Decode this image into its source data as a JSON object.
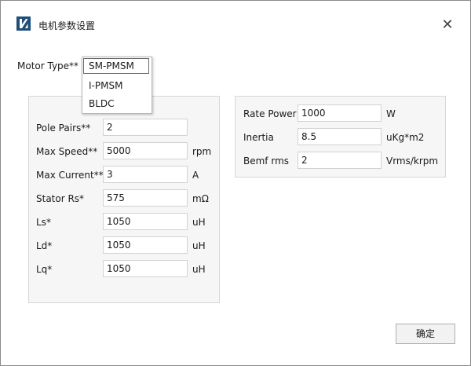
{
  "window": {
    "title": "电机参数设置",
    "app_icon": "app-logo-icon",
    "close_glyph": "✕"
  },
  "motor_type": {
    "label": "Motor Type**",
    "selected": "SM-PMSM",
    "options": [
      "I-PMSM",
      "BLDC"
    ]
  },
  "left_panel": {
    "rows": [
      {
        "label": "Pole Pairs**",
        "value": "2",
        "unit": ""
      },
      {
        "label": "Max Speed**",
        "value": "5000",
        "unit": "rpm"
      },
      {
        "label": "Max Current**",
        "value": "3",
        "unit": "A"
      },
      {
        "label": "Stator Rs*",
        "value": "575",
        "unit": "mΩ"
      },
      {
        "label": "Ls*",
        "value": "1050",
        "unit": "uH"
      },
      {
        "label": "Ld*",
        "value": "1050",
        "unit": "uH"
      },
      {
        "label": "Lq*",
        "value": "1050",
        "unit": "uH"
      }
    ]
  },
  "right_panel": {
    "rows": [
      {
        "label": "Rate Power",
        "value": "1000",
        "unit": "W"
      },
      {
        "label": "Inertia",
        "value": "8.5",
        "unit": "uKg*m2"
      },
      {
        "label": "Bemf rms",
        "value": "2",
        "unit": "Vrms/krpm"
      }
    ]
  },
  "footer": {
    "ok_label": "确定"
  },
  "colors": {
    "app_icon_bg": "#1e4e79",
    "panel_bg": "#f6f6f6",
    "border": "#d6d6d6"
  }
}
